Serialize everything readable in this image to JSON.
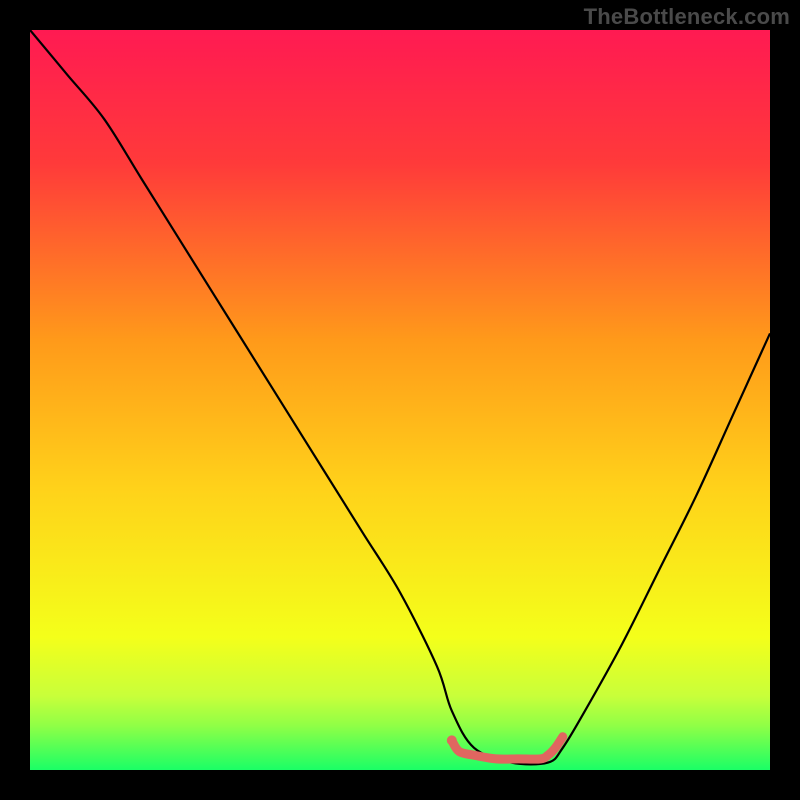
{
  "watermark": "TheBottleneck.com",
  "chart_data": {
    "type": "line",
    "title": "",
    "xlabel": "",
    "ylabel": "",
    "xlim": [
      0,
      100
    ],
    "ylim": [
      0,
      100
    ],
    "grid": false,
    "legend": false,
    "background_gradient": {
      "top_color": "#ff1a52",
      "mid_color": "#ffd21a",
      "bottom_color": "#1aff66"
    },
    "series": [
      {
        "name": "bottleneck-curve",
        "color": "#000000",
        "x": [
          0,
          5,
          10,
          15,
          20,
          25,
          30,
          35,
          40,
          45,
          50,
          55,
          57,
          60,
          65,
          70,
          72,
          75,
          80,
          85,
          90,
          95,
          100
        ],
        "y": [
          100,
          94,
          88,
          80,
          72,
          64,
          56,
          48,
          40,
          32,
          24,
          14,
          8,
          3,
          1,
          1,
          3,
          8,
          17,
          27,
          37,
          48,
          59
        ]
      },
      {
        "name": "optimal-range-marker",
        "color": "#e06660",
        "style": "thick",
        "x": [
          57,
          58,
          60,
          63,
          66,
          69,
          70,
          71,
          72
        ],
        "y": [
          4,
          2.5,
          2,
          1.5,
          1.5,
          1.5,
          2,
          3,
          4.5
        ]
      }
    ],
    "markers": [
      {
        "name": "optimal-start-dot",
        "x": 57,
        "y": 4,
        "color": "#e06660"
      }
    ]
  }
}
